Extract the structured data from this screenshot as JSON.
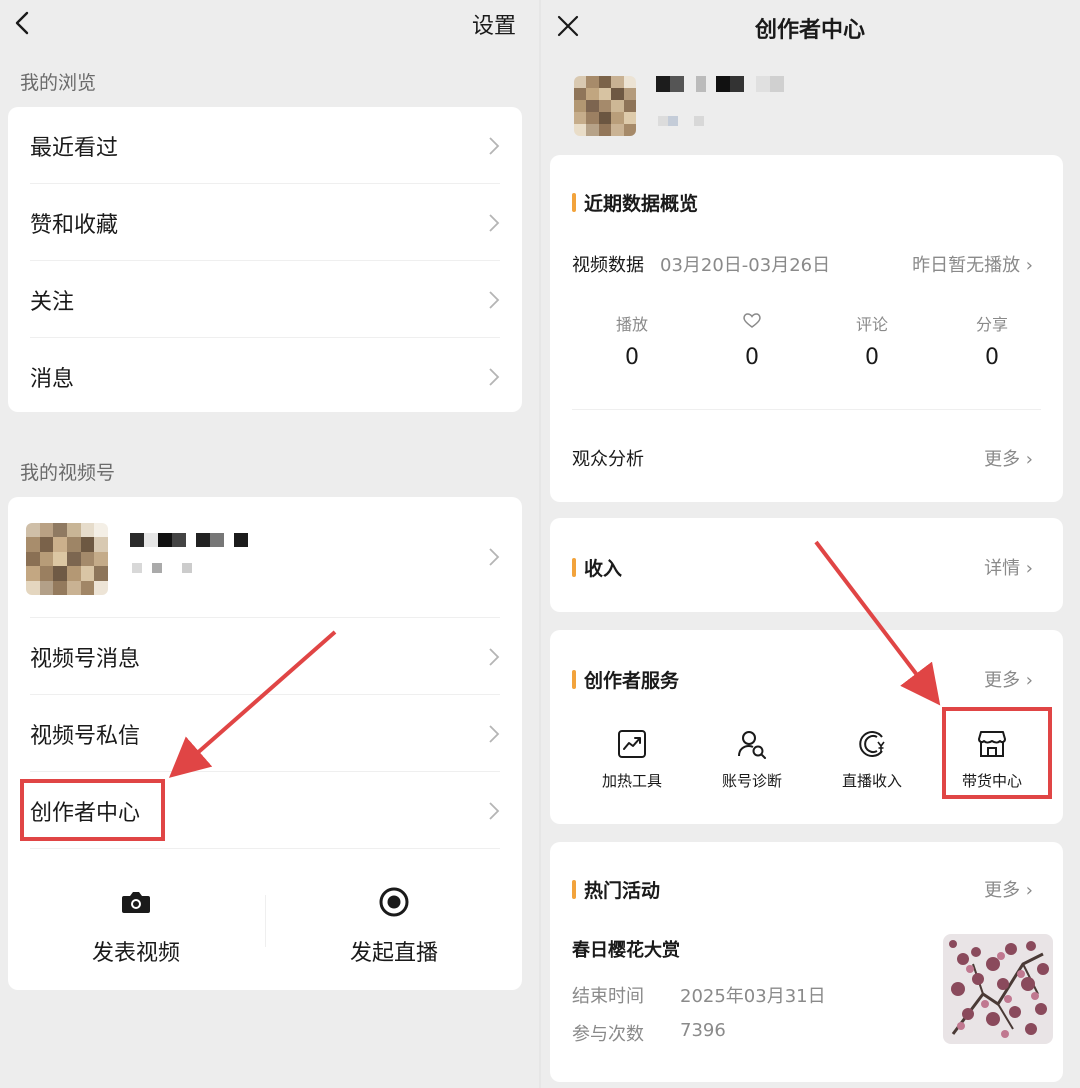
{
  "left": {
    "header": {
      "settings": "设置"
    },
    "browse": {
      "label": "我的浏览",
      "items": [
        "最近看过",
        "赞和收藏",
        "关注",
        "消息"
      ]
    },
    "channels": {
      "label": "我的视频号",
      "items": [
        "视频号消息",
        "视频号私信",
        "创作者中心"
      ],
      "actions": {
        "post_video": "发表视频",
        "start_live": "发起直播"
      }
    }
  },
  "right": {
    "title": "创作者中心",
    "overview": {
      "title": "近期数据概览",
      "video_data_label": "视频数据",
      "date_range": "03月20日-03月26日",
      "status": "昨日暂无播放",
      "stats": [
        {
          "label": "播放",
          "value": "0"
        },
        {
          "label": "",
          "icon": "heart-icon",
          "value": "0"
        },
        {
          "label": "评论",
          "value": "0"
        },
        {
          "label": "分享",
          "value": "0"
        }
      ],
      "audience_label": "观众分析",
      "audience_more": "更多"
    },
    "income": {
      "title": "收入",
      "more": "详情"
    },
    "services": {
      "title": "创作者服务",
      "more": "更多",
      "items": [
        {
          "label": "加热工具",
          "icon": "trend-chart-icon"
        },
        {
          "label": "账号诊断",
          "icon": "user-search-icon"
        },
        {
          "label": "直播收入",
          "icon": "yuan-circle-icon"
        },
        {
          "label": "带货中心",
          "icon": "store-icon"
        }
      ]
    },
    "events": {
      "title": "热门活动",
      "more": "更多",
      "name": "春日樱花大赏",
      "end_label": "结束时间",
      "end_value": "2025年03月31日",
      "count_label": "参与次数",
      "count_value": "7396"
    }
  },
  "colors": {
    "accent_bar": "#f2a33c",
    "highlight": "#e04545",
    "page_bg": "#ededed"
  }
}
